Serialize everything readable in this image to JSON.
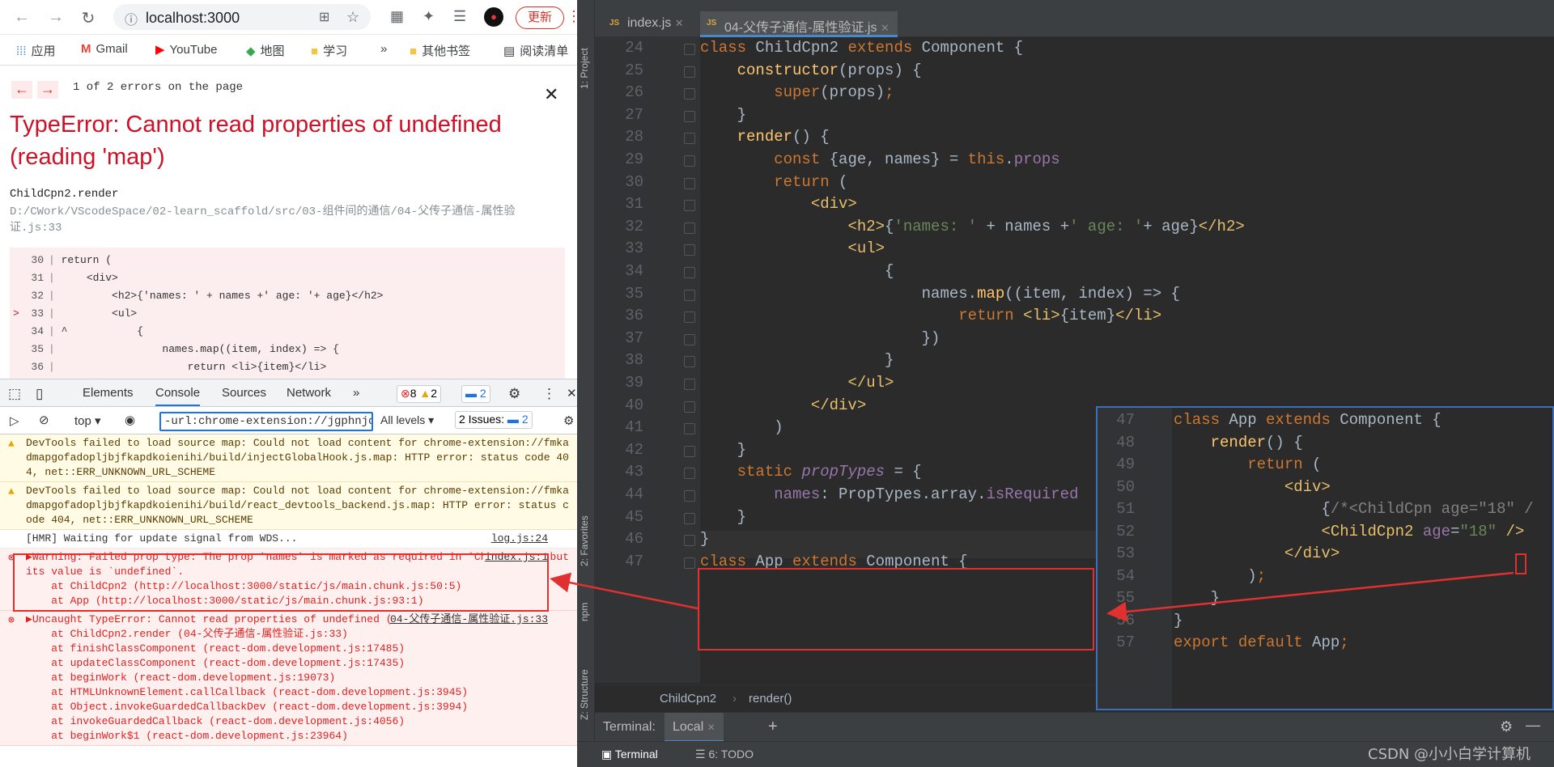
{
  "browser": {
    "url": "localhost:3000",
    "update_label": "更新",
    "bookmarks": [
      "应用",
      "Gmail",
      "YouTube",
      "地图",
      "学习",
      "»",
      "其他书签",
      "阅读清单"
    ]
  },
  "overlay": {
    "count_text": "1 of 2 errors on the page",
    "title": "TypeError: Cannot read properties of undefined (reading 'map')",
    "function": "ChildCpn2.render",
    "path": "D:/CWork/VScodeSpace/02-learn_scaffold/src/03-组件间的通信/04-父传子通信-属性验证.js:33",
    "code_lines": [
      {
        "marker": "",
        "num": "30",
        "code": "return ("
      },
      {
        "marker": "",
        "num": "31",
        "code": "    <div>"
      },
      {
        "marker": "",
        "num": "32",
        "code": "        <h2>{'names: ' + names +' age: '+ age}</h2>"
      },
      {
        "marker": ">",
        "num": "33",
        "code": "        <ul>"
      },
      {
        "marker": "",
        "num": "34",
        "code": "^           {"
      },
      {
        "marker": "",
        "num": "35",
        "code": "                names.map((item, index) => {"
      },
      {
        "marker": "",
        "num": "36",
        "code": "                    return <li>{item}</li>"
      }
    ]
  },
  "devtools": {
    "tabs": [
      "Elements",
      "Console",
      "Sources",
      "Network",
      "»"
    ],
    "errors_count": "8",
    "warnings_count": "2",
    "issues_badge": "2",
    "context": "top",
    "filter_value": "-url:chrome-extension://jgphnjokjhj",
    "levels": "All levels",
    "issues_label": "2 Issues:",
    "issues_count": "2",
    "messages": [
      {
        "type": "warn",
        "text": "DevTools failed to load source map: Could not load content for chrome-extension://fmkadmapgofadopljbjfkapdkoienihi/build/injectGlobalHook.js.map: HTTP error: status code 404, net::ERR_UNKNOWN_URL_SCHEME",
        "source": ""
      },
      {
        "type": "warn",
        "text": "DevTools failed to load source map: Could not load content for chrome-extension://fmkadmapgofadopljbjfkapdkoienihi/build/react_devtools_backend.js.map: HTTP error: status code 404, net::ERR_UNKNOWN_URL_SCHEME",
        "source": ""
      },
      {
        "type": "info",
        "text": "[HMR] Waiting for update signal from WDS...",
        "source": "log.js:24"
      },
      {
        "type": "err",
        "text": "▶Warning: Failed prop type: The prop `names` is marked as required in `ChildCpn2`, but its value is `undefined`.\n    at ChildCpn2 (http://localhost:3000/static/js/main.chunk.js:50:5)\n    at App (http://localhost:3000/static/js/main.chunk.js:93:1)",
        "source": "index.js:1"
      },
      {
        "type": "err",
        "text": "▶Uncaught TypeError: Cannot read properties of undefined (reading 'map')\n    at ChildCpn2.render (04-父传子通信-属性验证.js:33)\n    at finishClassComponent (react-dom.development.js:17485)\n    at updateClassComponent (react-dom.development.js:17435)\n    at beginWork (react-dom.development.js:19073)\n    at HTMLUnknownElement.callCallback (react-dom.development.js:3945)\n    at Object.invokeGuardedCallbackDev (react-dom.development.js:3994)\n    at invokeGuardedCallback (react-dom.development.js:4056)\n    at beginWork$1 (react-dom.development.js:23964)",
        "source": "04-父传子通信-属性验证.js:33"
      }
    ]
  },
  "ide": {
    "side_labels": [
      "1: Project",
      "2: Favorites",
      "npm",
      "Z: Structure"
    ],
    "tabs": [
      "index.js",
      "04-父传子通信-属性验证.js"
    ],
    "tab_type_label": "JS",
    "lines": [
      {
        "n": "24",
        "html": "<span class='kw'>class</span> ChildCpn2 <span class='kw'>extends</span> Component {"
      },
      {
        "n": "25",
        "html": "    <span class='fnc'>constructor</span>(props) {"
      },
      {
        "n": "26",
        "html": "        <span class='kw'>super</span>(props)<span class='kw'>;</span>"
      },
      {
        "n": "27",
        "html": "    }"
      },
      {
        "n": "28",
        "html": "    <span class='fnc'>render</span>() {"
      },
      {
        "n": "29",
        "html": "        <span class='kw'>const</span> {age, names} = <span class='kw'>this</span>.<span class='prop'>props</span>"
      },
      {
        "n": "30",
        "html": "        <span class='kw'>return</span> ("
      },
      {
        "n": "31",
        "html": "            <span class='tag'>&lt;div&gt;</span>"
      },
      {
        "n": "32",
        "html": "                <span class='tag'>&lt;h2&gt;</span>{<span class='str'>'names: '</span> + names +<span class='str'>' age: '</span>+ age}<span class='tag'>&lt;/h2&gt;</span>"
      },
      {
        "n": "33",
        "html": "                <span class='tag'>&lt;ul&gt;</span>"
      },
      {
        "n": "34",
        "html": "                    {"
      },
      {
        "n": "35",
        "html": "                        names.<span class='fnc'>map</span>((item, index) => {"
      },
      {
        "n": "36",
        "html": "                            <span class='kw'>return</span> <span class='tag'>&lt;li&gt;</span>{item}<span class='tag'>&lt;/li&gt;</span>"
      },
      {
        "n": "37",
        "html": "                        })"
      },
      {
        "n": "38",
        "html": "                    }"
      },
      {
        "n": "39",
        "html": "                <span class='tag'>&lt;/ul&gt;</span>"
      },
      {
        "n": "40",
        "html": "            <span class='tag'>&lt;/div&gt;</span>"
      },
      {
        "n": "41",
        "html": "        )"
      },
      {
        "n": "42",
        "html": "    }"
      },
      {
        "n": "43",
        "html": "    <span class='kw'>static</span> <span class='prop it'>propTypes</span> = {"
      },
      {
        "n": "44",
        "html": "        <span class='prop'>names</span>: PropTypes.array.<span class='prop'>isRequired</span>"
      },
      {
        "n": "45",
        "html": "    }"
      },
      {
        "n": "46",
        "html": "}"
      },
      {
        "n": "47",
        "html": "<span class='kw'>class</span> App <span class='kw'>extends</span> Component {"
      }
    ],
    "popup_lines": [
      {
        "n": "47",
        "html": "<span class='kw'>class</span> App <span class='kw'>extends</span> Component {"
      },
      {
        "n": "48",
        "html": "    <span class='fnc'>render</span>() {"
      },
      {
        "n": "49",
        "html": "        <span class='kw'>return</span> ("
      },
      {
        "n": "50",
        "html": "            <span class='tag'>&lt;div&gt;</span>"
      },
      {
        "n": "51",
        "html": "                {<span style='color:#808080'>/*&lt;ChildCpn age=\"18\" /</span>"
      },
      {
        "n": "52",
        "html": "                <span class='tag'>&lt;ChildCpn2</span> <span class='prop'>age</span>=<span class='str'>\"18\"</span> <span class='tag'>/&gt;</span>"
      },
      {
        "n": "53",
        "html": "            <span class='tag'>&lt;/div&gt;</span>"
      },
      {
        "n": "54",
        "html": "        )<span class='kw'>;</span>"
      },
      {
        "n": "55",
        "html": "    }"
      },
      {
        "n": "56",
        "html": "}"
      },
      {
        "n": "57",
        "html": "<span class='kw'>export default</span> App<span class='kw'>;</span>"
      }
    ],
    "breadcrumb": [
      "ChildCpn2",
      "render()"
    ],
    "terminal_label": "Terminal:",
    "terminal_tab": "Local",
    "bottom_tools": [
      "Terminal",
      "6: TODO"
    ],
    "watermark": "CSDN @小小白学计算机"
  }
}
